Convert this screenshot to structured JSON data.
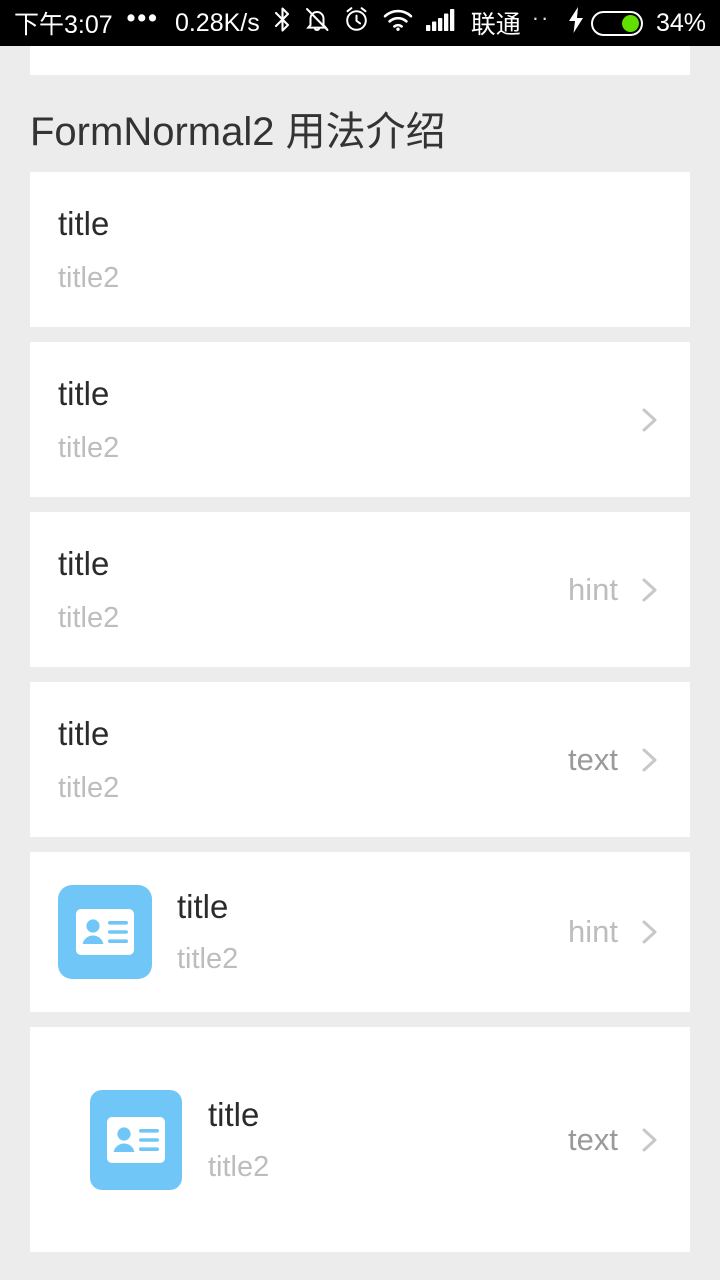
{
  "status_bar": {
    "time": "下午3:07",
    "overflow_dots": "•••",
    "network_speed": "0.28K/s",
    "icons": [
      "bluetooth-icon",
      "vibrate-off-icon",
      "alarm-icon",
      "wifi-icon",
      "signal-icon"
    ],
    "carrier": "联通",
    "sim_dots": "··",
    "charging_icon": "lightning-bolt-icon",
    "battery_percent": "34%",
    "battery_color": "#5FE000",
    "background": "#000000"
  },
  "page": {
    "title": "FormNormal2 用法介绍",
    "background": "#ececec",
    "card_background": "#ffffff",
    "accent_color": "#70c7f7"
  },
  "rows": [
    {
      "title": "title",
      "subtitle": "title2",
      "value": "",
      "value_kind": "",
      "icon": "",
      "chevron": false
    },
    {
      "title": "title",
      "subtitle": "title2",
      "value": "",
      "value_kind": "",
      "icon": "",
      "chevron": true
    },
    {
      "title": "title",
      "subtitle": "title2",
      "value": "hint",
      "value_kind": "hint",
      "icon": "",
      "chevron": true
    },
    {
      "title": "title",
      "subtitle": "title2",
      "value": "text",
      "value_kind": "text",
      "icon": "",
      "chevron": true
    },
    {
      "title": "title",
      "subtitle": "title2",
      "value": "hint",
      "value_kind": "hint",
      "icon": "contact-card-icon",
      "chevron": true
    },
    {
      "title": "title",
      "subtitle": "title2",
      "value": "text",
      "value_kind": "text",
      "icon": "contact-card-icon",
      "chevron": true
    }
  ]
}
